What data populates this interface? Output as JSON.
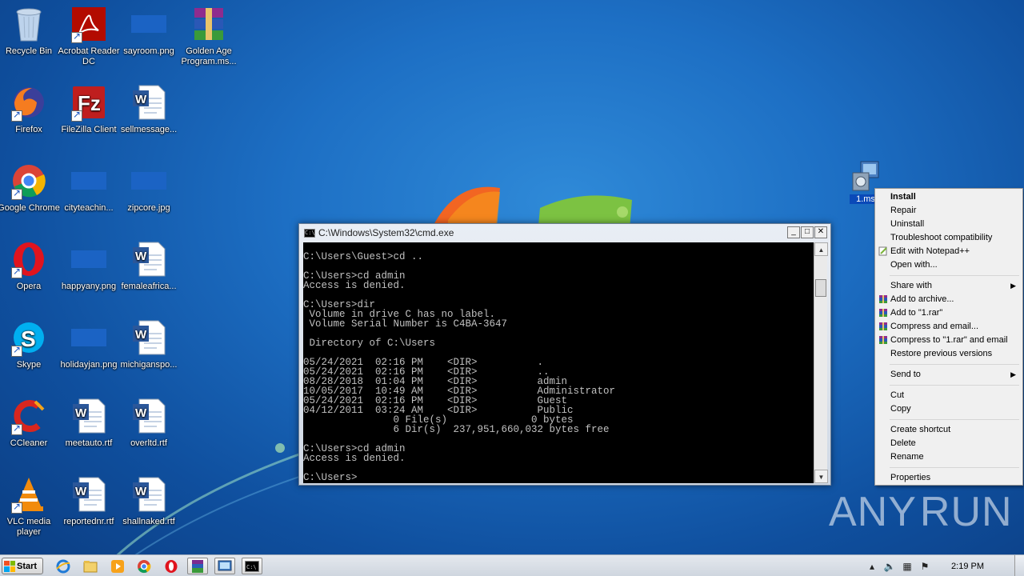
{
  "desktop": {
    "icons": [
      {
        "label": "Recycle Bin",
        "icon": "recycle-bin-icon"
      },
      {
        "label": "Acrobat Reader DC",
        "icon": "acrobat-icon"
      },
      {
        "label": "sayroom.png",
        "icon": "image-file-icon"
      },
      {
        "label": "Golden Age Program.ms...",
        "icon": "winrar-archive-icon"
      },
      {
        "label": "Firefox",
        "icon": "firefox-icon"
      },
      {
        "label": "FileZilla Client",
        "icon": "filezilla-icon"
      },
      {
        "label": "sellmessage...",
        "icon": "word-document-icon"
      },
      {
        "label": "Google Chrome",
        "icon": "chrome-icon"
      },
      {
        "label": "cityteachin...",
        "icon": "image-file-icon"
      },
      {
        "label": "zipcore.jpg",
        "icon": "image-file-icon"
      },
      {
        "label": "Opera",
        "icon": "opera-icon"
      },
      {
        "label": "happyany.png",
        "icon": "image-file-icon"
      },
      {
        "label": "femaleafrica...",
        "icon": "word-document-icon"
      },
      {
        "label": "Skype",
        "icon": "skype-icon"
      },
      {
        "label": "holidayjan.png",
        "icon": "image-file-icon"
      },
      {
        "label": "michiganspo...",
        "icon": "word-document-icon"
      },
      {
        "label": "CCleaner",
        "icon": "ccleaner-icon"
      },
      {
        "label": "meetauto.rtf",
        "icon": "word-document-icon"
      },
      {
        "label": "overltd.rtf",
        "icon": "word-document-icon"
      },
      {
        "label": "VLC media player",
        "icon": "vlc-icon"
      },
      {
        "label": "reportednr.rtf",
        "icon": "word-document-icon"
      },
      {
        "label": "shallnaked.rtf",
        "icon": "word-document-icon"
      }
    ],
    "selected_file": {
      "label": "1.ms",
      "icon": "installer-package-icon"
    },
    "watermark": {
      "left": "ANY",
      "right": "RUN"
    }
  },
  "cmd": {
    "title": "C:\\Windows\\System32\\cmd.exe",
    "lines": [
      "C:\\Users\\Guest>cd ..",
      "",
      "C:\\Users>cd admin",
      "Access is denied.",
      "",
      "C:\\Users>dir",
      " Volume in drive C has no label.",
      " Volume Serial Number is C4BA-3647",
      "",
      " Directory of C:\\Users",
      "",
      "05/24/2021  02:16 PM    <DIR>          .",
      "05/24/2021  02:16 PM    <DIR>          ..",
      "08/28/2018  01:04 PM    <DIR>          admin",
      "10/05/2017  10:49 AM    <DIR>          Administrator",
      "05/24/2021  02:16 PM    <DIR>          Guest",
      "04/12/2011  03:24 AM    <DIR>          Public",
      "               0 File(s)              0 bytes",
      "               6 Dir(s)  237,951,660,032 bytes free",
      "",
      "C:\\Users>cd admin",
      "Access is denied.",
      "",
      "C:\\Users>"
    ]
  },
  "context_menu": {
    "items": [
      {
        "label": "Install",
        "bold": true
      },
      {
        "label": "Repair"
      },
      {
        "label": "Uninstall"
      },
      {
        "label": "Troubleshoot compatibility"
      },
      {
        "label": "Edit with Notepad++",
        "icon": "notepadpp-icon"
      },
      {
        "label": "Open with..."
      },
      {
        "separator": true
      },
      {
        "label": "Share with",
        "submenu": true
      },
      {
        "label": "Add to archive...",
        "icon": "winrar-icon"
      },
      {
        "label": "Add to \"1.rar\"",
        "icon": "winrar-icon"
      },
      {
        "label": "Compress and email...",
        "icon": "winrar-icon"
      },
      {
        "label": "Compress to \"1.rar\" and email",
        "icon": "winrar-icon"
      },
      {
        "label": "Restore previous versions"
      },
      {
        "separator": true
      },
      {
        "label": "Send to",
        "submenu": true
      },
      {
        "separator": true
      },
      {
        "label": "Cut"
      },
      {
        "label": "Copy"
      },
      {
        "separator": true
      },
      {
        "label": "Create shortcut"
      },
      {
        "label": "Delete"
      },
      {
        "label": "Rename"
      },
      {
        "separator": true
      },
      {
        "label": "Properties"
      }
    ]
  },
  "taskbar": {
    "start_label": "Start",
    "pinned": [
      "ie-icon",
      "explorer-icon",
      "media-player-icon",
      "chrome-icon",
      "opera-icon",
      "winrar-icon",
      "installer-icon",
      "cmd-icon"
    ],
    "clock": "2:19 PM"
  }
}
